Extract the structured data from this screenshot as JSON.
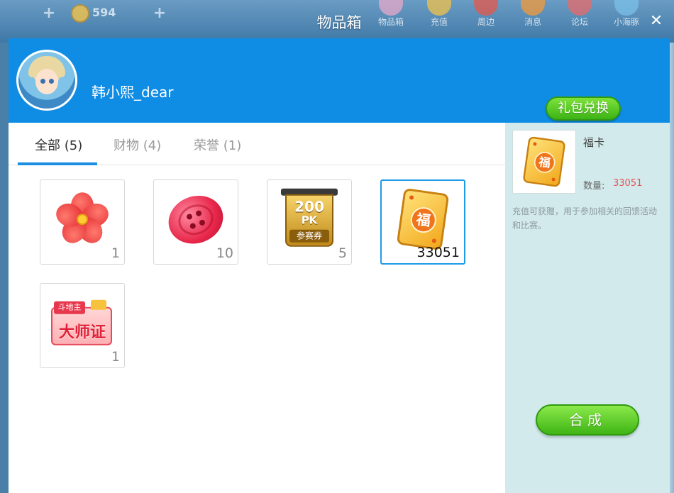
{
  "background": {
    "coin_value": "594",
    "nav": [
      "物品箱",
      "充值",
      "周边",
      "消息",
      "论坛",
      "小海豚"
    ]
  },
  "window": {
    "title": "物品箱",
    "close_icon": "close-icon"
  },
  "header": {
    "username": "韩小熙_dear",
    "redeem_label": "礼包兑换"
  },
  "tabs": [
    {
      "label": "全部 (5)",
      "active": true
    },
    {
      "label": "财物 (4)",
      "active": false
    },
    {
      "label": "荣誉 (1)",
      "active": false
    }
  ],
  "items": [
    {
      "icon": "flower-icon",
      "count": "1"
    },
    {
      "icon": "button-icon",
      "count": "10"
    },
    {
      "icon": "ticket-icon",
      "count": "5",
      "ticket_number": "200",
      "ticket_pk": "PK",
      "ticket_label": "参赛券"
    },
    {
      "icon": "fu-card-icon",
      "count": "33051",
      "glyph": "福",
      "selected": true
    },
    {
      "icon": "master-certificate-icon",
      "count": "1",
      "tag": "斗地主",
      "title": "大师证"
    }
  ],
  "detail": {
    "name": "福卡",
    "quantity_label": "数量:",
    "quantity": "33051",
    "description": "充值可获赠，用于参加相关的回馈活动和比赛。",
    "glyph": "福"
  },
  "compose_label": "合成",
  "colors": {
    "header_blue": "#0f8de4",
    "accent_green": "#3fb515",
    "quantity_red": "#e35555",
    "selected_border": "#1e9be8"
  }
}
